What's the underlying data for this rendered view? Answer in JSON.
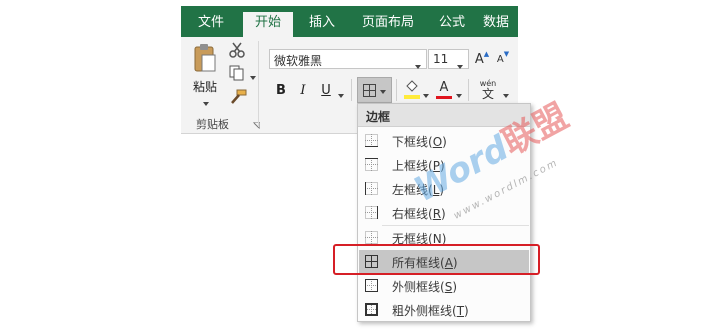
{
  "tabs": [
    {
      "label": "文件",
      "active": false
    },
    {
      "label": "开始",
      "active": true
    },
    {
      "label": "插入",
      "active": false
    },
    {
      "label": "页面布局",
      "active": false
    },
    {
      "label": "公式",
      "active": false
    },
    {
      "label": "数据",
      "active": false
    }
  ],
  "clipboard": {
    "paste_label": "粘贴",
    "group_label": "剪贴板"
  },
  "font": {
    "name": "微软雅黑",
    "size": "11",
    "bold": "B",
    "italic": "I",
    "underline": "U",
    "grow": "A",
    "shrink": "A",
    "color_letter": "A",
    "phonetic_top": "wén",
    "phonetic_bottom": "文"
  },
  "colors": {
    "brand": "#217346",
    "fill_highlight": "#ffeb3b",
    "font_color": "#e0141e",
    "highlight_box": "#d61f26"
  },
  "border_menu": {
    "header": "边框",
    "items": [
      {
        "label": "下框线",
        "key": "O",
        "icon": "bottom-border-icon"
      },
      {
        "label": "上框线",
        "key": "P",
        "icon": "top-border-icon"
      },
      {
        "label": "左框线",
        "key": "L",
        "icon": "left-border-icon"
      },
      {
        "label": "右框线",
        "key": "R",
        "icon": "right-border-icon"
      },
      {
        "label": "无框线",
        "key": "N",
        "icon": "no-border-icon"
      },
      {
        "label": "所有框线",
        "key": "A",
        "icon": "all-borders-icon",
        "highlighted": true
      },
      {
        "label": "外侧框线",
        "key": "S",
        "icon": "outside-borders-icon"
      },
      {
        "label": "粗外侧框线",
        "key": "T",
        "icon": "thick-outside-border-icon"
      }
    ]
  },
  "watermark": {
    "brand_en": "Word",
    "brand_cn": "联盟",
    "url": "www.wordlm.com"
  }
}
